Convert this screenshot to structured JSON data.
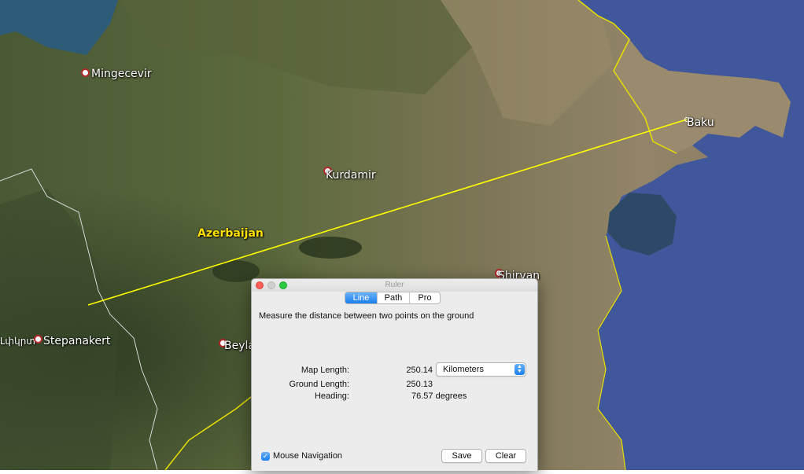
{
  "map": {
    "places": [
      {
        "name": "Mingecevir"
      },
      {
        "name": "Kurdamir"
      },
      {
        "name": "Baku"
      },
      {
        "name": "Shirvan"
      },
      {
        "name": "Stepanakert"
      },
      {
        "name": "Beyla"
      },
      {
        "name": "Azerbaijan"
      },
      {
        "name": "Լփկրտ"
      }
    ],
    "colors": {
      "ruler_line": "#ffff00",
      "border": "#e8e000",
      "sea": "#40579b"
    }
  },
  "ruler": {
    "window_title": "Ruler",
    "tabs": [
      {
        "label": "Line"
      },
      {
        "label": "Path"
      },
      {
        "label": "Pro"
      }
    ],
    "active_tab": "Line",
    "description": "Measure the distance between two points on the ground",
    "map_length_label": "Map Length:",
    "map_length_value": "250.14",
    "units": "Kilometers",
    "ground_length_label": "Ground Length:",
    "ground_length_value": "250.13",
    "heading_label": "Heading:",
    "heading_value": "76.57 degrees",
    "mouse_nav_label": "Mouse Navigation",
    "mouse_nav_checked": true,
    "save_label": "Save",
    "clear_label": "Clear"
  }
}
